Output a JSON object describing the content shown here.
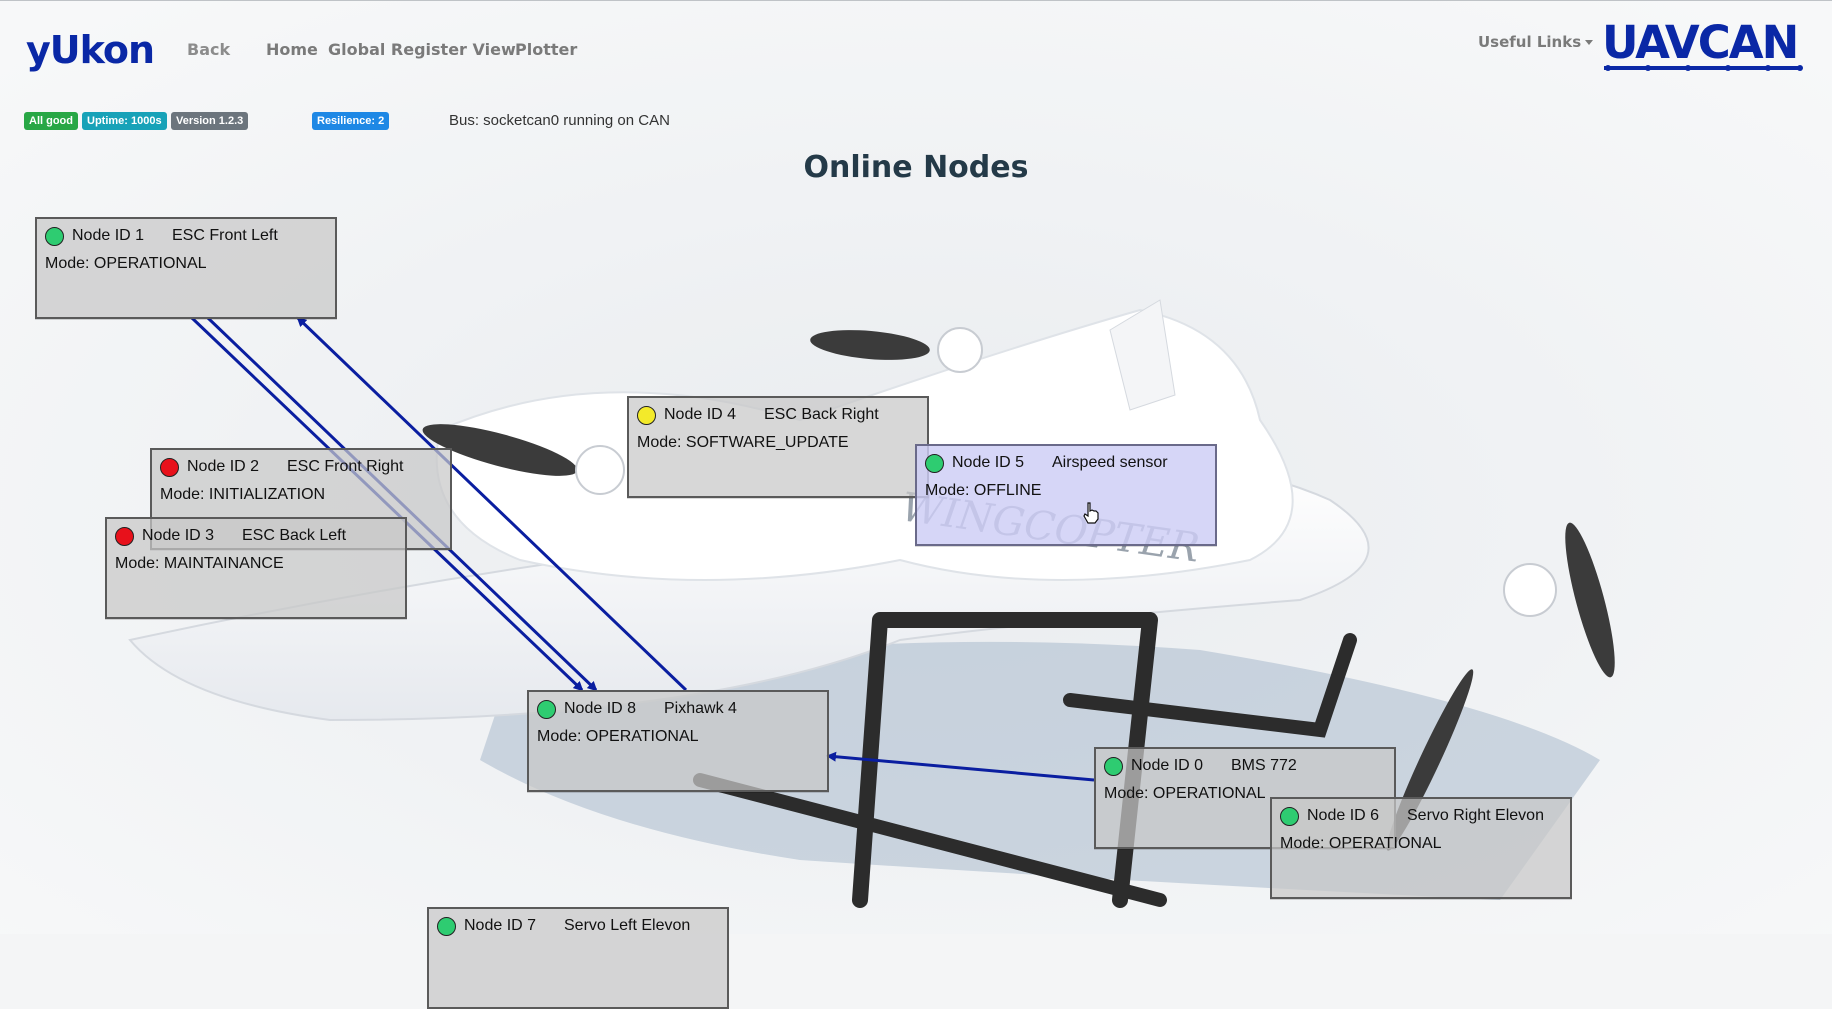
{
  "app": {
    "logo": "yUkon",
    "brand": "UAVCAN",
    "nav": {
      "back": "Back",
      "home": "Home",
      "global_register_view": "Global Register View",
      "plotter": "Plotter",
      "useful_links": "Useful Links"
    }
  },
  "status": {
    "health": "All good",
    "uptime": "Uptime: 1000s",
    "version": "Version 1.2.3",
    "resilience": "Resilience: 2",
    "bus": "Bus: socketcan0 running on CAN"
  },
  "page_title": "Online Nodes",
  "status_colors": {
    "green": "#2ecc71",
    "red": "#e8111b",
    "yellow": "#f3ea2a"
  },
  "link_color": "#0a1ea0",
  "nodes": [
    {
      "id": "Node ID 1",
      "name": "ESC Front Left",
      "mode": "Mode: OPERATIONAL",
      "status": "green"
    },
    {
      "id": "Node ID 2",
      "name": "ESC Front Right",
      "mode": "Mode: INITIALIZATION",
      "status": "red"
    },
    {
      "id": "Node ID 3",
      "name": "ESC Back Left",
      "mode": "Mode: MAINTAINANCE",
      "status": "red"
    },
    {
      "id": "Node ID 4",
      "name": "ESC Back Right",
      "mode": "Mode: SOFTWARE_UPDATE",
      "status": "yellow"
    },
    {
      "id": "Node ID 5",
      "name": "Airspeed sensor",
      "mode": "Mode: OFFLINE",
      "status": "green"
    },
    {
      "id": "Node ID 8",
      "name": "Pixhawk 4",
      "mode": "Mode: OPERATIONAL",
      "status": "green"
    },
    {
      "id": "Node ID 0",
      "name": "BMS 772",
      "mode": "Mode: OPERATIONAL",
      "status": "green"
    },
    {
      "id": "Node ID 6",
      "name": "Servo Right Elevon",
      "mode": "Mode: OPERATIONAL",
      "status": "green"
    },
    {
      "id": "Node ID 7",
      "name": "Servo Left Elevon",
      "mode": "",
      "status": "green"
    }
  ],
  "background_watermark": "WINGCOPTER"
}
